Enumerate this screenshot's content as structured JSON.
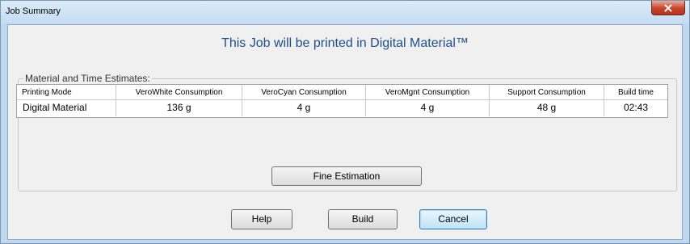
{
  "window": {
    "title": "Job Summary",
    "close_icon": "close-icon"
  },
  "headline": "This Job will be printed in Digital Material™",
  "group": {
    "label": "Material and Time Estimates:"
  },
  "table": {
    "columns": [
      "Printing Mode",
      "VeroWhite Consumption",
      "VeroCyan Consumption",
      "VeroMgnt Consumption",
      "Support Consumption",
      "Build time"
    ],
    "rows": [
      [
        "Digital Material",
        "136 g",
        "4 g",
        "4 g",
        "48 g",
        "02:43"
      ]
    ]
  },
  "buttons": {
    "fine_estimation": "Fine Estimation",
    "help": "Help",
    "build": "Build",
    "cancel": "Cancel"
  },
  "colors": {
    "headline": "#1f4e8c",
    "close_button": "#c7432a"
  }
}
